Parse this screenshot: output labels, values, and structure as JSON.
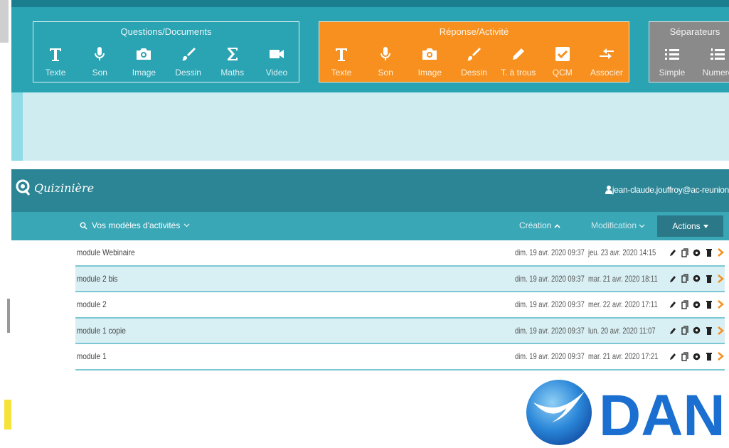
{
  "toolbar": {
    "questions": {
      "title": "Questions/Documents",
      "items": [
        {
          "label": "Texte",
          "icon": "text-icon"
        },
        {
          "label": "Son",
          "icon": "microphone-icon"
        },
        {
          "label": "Image",
          "icon": "camera-icon"
        },
        {
          "label": "Dessin",
          "icon": "brush-icon"
        },
        {
          "label": "Maths",
          "icon": "sigma-icon"
        },
        {
          "label": "Video",
          "icon": "video-icon"
        }
      ]
    },
    "reponse": {
      "title": "Réponse/Activité",
      "items": [
        {
          "label": "Texte",
          "icon": "text-icon"
        },
        {
          "label": "Son",
          "icon": "microphone-icon"
        },
        {
          "label": "Image",
          "icon": "camera-icon"
        },
        {
          "label": "Dessin",
          "icon": "brush-icon"
        },
        {
          "label": "T. à trous",
          "icon": "pencil-icon"
        },
        {
          "label": "QCM",
          "icon": "checkbox-icon"
        },
        {
          "label": "Associer",
          "icon": "arrows-icon"
        }
      ]
    },
    "separateurs": {
      "title": "Séparateurs",
      "items": [
        {
          "label": "Simple",
          "icon": "list-icon"
        },
        {
          "label": "Numero",
          "icon": "numbered-list-icon"
        }
      ]
    }
  },
  "app": {
    "logo": "Quizinière",
    "user": "jean-claude.jouffroy@ac-reunion",
    "search_label": "Vos modèles d'activités",
    "col_creation": "Création",
    "col_modification": "Modification",
    "actions": "Actions",
    "rows": [
      {
        "name": "module Webinaire",
        "created": "dim. 19 avr. 2020 09:37",
        "modified": "jeu. 23 avr. 2020 14:15"
      },
      {
        "name": "module 2 bis",
        "created": "dim. 19 avr. 2020 09:37",
        "modified": "mar. 21 avr. 2020 18:11"
      },
      {
        "name": "module 2",
        "created": "dim. 19 avr. 2020 09:37",
        "modified": "mer. 22 avr. 2020 17:11"
      },
      {
        "name": "module 1 copie",
        "created": "dim. 19 avr. 2020 09:37",
        "modified": "lun. 20 avr. 2020 11:07"
      },
      {
        "name": "module 1",
        "created": "dim. 19 avr. 2020 09:37",
        "modified": "mar. 21 avr. 2020 17:21"
      }
    ]
  },
  "dane": {
    "text": "DANE"
  },
  "colors": {
    "teal": "#2aa3b3",
    "orange": "#f7901e",
    "gray": "#8a8a8a",
    "header_teal": "#2c8595",
    "row_alt": "#d8eff3",
    "action_orange": "#f7901e",
    "dane_blue": "#1b6fd0"
  }
}
